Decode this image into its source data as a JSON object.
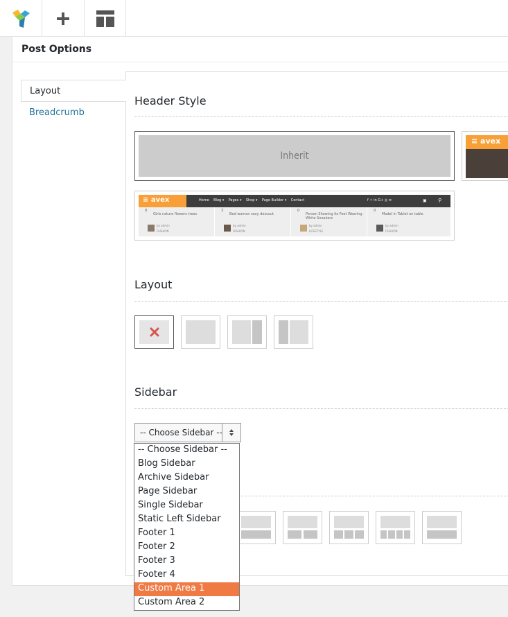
{
  "toolbar": {
    "logo_icon": "builder-logo-icon",
    "add_icon": "plus-icon",
    "templates_icon": "template-layout-icon"
  },
  "box": {
    "title": "Post Options"
  },
  "tabs": [
    {
      "label": "Layout",
      "active": true
    },
    {
      "label": "Breadcrumb",
      "active": false
    }
  ],
  "sections": {
    "header_style": "Header Style",
    "layout": "Layout",
    "sidebar": "Sidebar"
  },
  "header_options": {
    "inherit_label": "Inherit",
    "preview_logo": "avex",
    "preview_menu": [
      "Home",
      "Blog ▾",
      "Pages ▾",
      "Shop ▾",
      "Page Builder ▾",
      "Contact"
    ],
    "preview_social": "f  ✧  in  G+  ◎  ≡",
    "preview_cards": [
      {
        "count": "0",
        "title": "Girls nature flowers trees",
        "author": "by admin",
        "cat": "FASHION"
      },
      {
        "count": "3",
        "title": "Bed woman sexy descout",
        "author": "by admin",
        "cat": "FASHION"
      },
      {
        "count": "0",
        "title": "Person Showing its Feet Wearing White Sneakers",
        "author": "by admin",
        "cat": "LIFESTYLE"
      },
      {
        "count": "0",
        "title": "Model in Tablet on table",
        "author": "by admin",
        "cat": "FASHION"
      }
    ]
  },
  "layout_options": [
    "no-sidebar",
    "full-width",
    "right-sidebar",
    "left-sidebar"
  ],
  "sidebar_select": {
    "value": "-- Choose Sidebar --",
    "options": [
      "-- Choose Sidebar --",
      "Blog Sidebar",
      "Archive Sidebar",
      "Page Sidebar",
      "Single Sidebar",
      "Static Left Sidebar",
      "Footer 1",
      "Footer 2",
      "Footer 3",
      "Footer 4",
      "Custom Area 1",
      "Custom Area 2"
    ],
    "highlighted": "Custom Area 1"
  },
  "colors": {
    "accent": "#f07a43",
    "brand_orange": "#f99f38",
    "link": "#21759b"
  }
}
